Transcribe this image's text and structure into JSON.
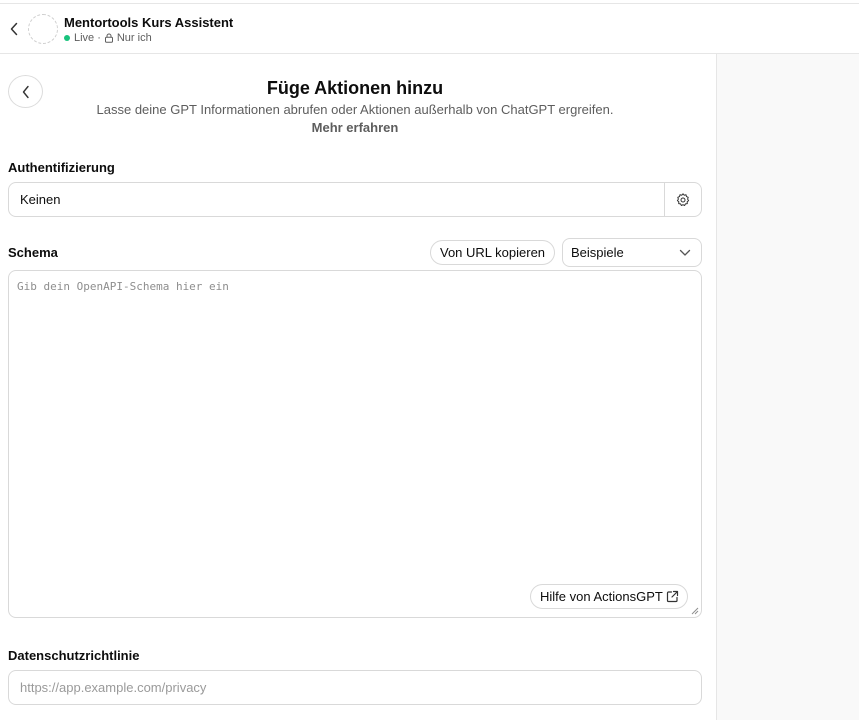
{
  "header": {
    "gpt_name": "Mentortools Kurs Assistent",
    "status": "Live",
    "separator": "·",
    "visibility": "Nur ich"
  },
  "main": {
    "title": "Füge Aktionen hinzu",
    "subtitle": "Lasse deine GPT Informationen abrufen oder Aktionen außerhalb von ChatGPT ergreifen.",
    "learn_more": "Mehr erfahren"
  },
  "authentication": {
    "label": "Authentifizierung",
    "value": "Keinen"
  },
  "schema": {
    "label": "Schema",
    "import_url_button": "Von URL kopieren",
    "examples_select": "Beispiele",
    "placeholder": "Gib dein OpenAPI-Schema hier ein",
    "help_button": "Hilfe von ActionsGPT"
  },
  "privacy": {
    "label": "Datenschutzrichtlinie",
    "placeholder": "https://app.example.com/privacy"
  },
  "colors": {
    "live_dot": "#19c37d",
    "right_pane": "#f9f9f9",
    "border": "#d9d9d9"
  },
  "icons": [
    "chevron-left-icon",
    "lock-icon",
    "gear-icon",
    "chevron-down-icon",
    "external-link-icon",
    "resize-grip-icon"
  ]
}
